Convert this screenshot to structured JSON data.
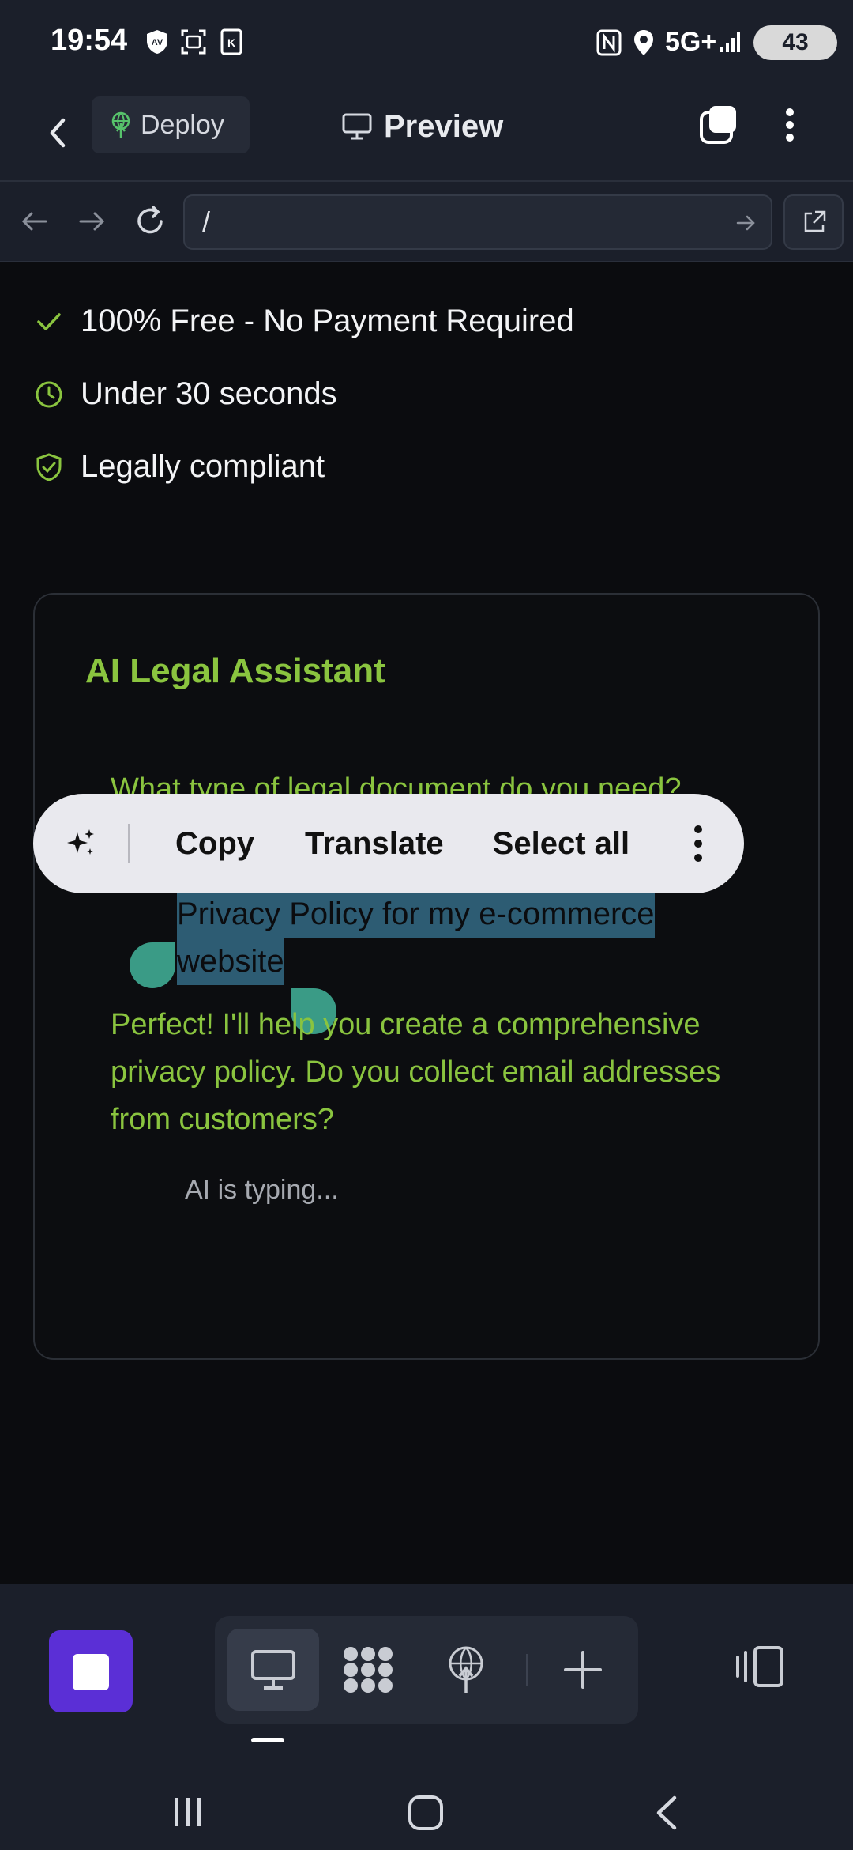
{
  "status_bar": {
    "time": "19:54",
    "network": "5G+",
    "battery": "43",
    "icons": [
      "av-shield-icon",
      "screenshot-icon",
      "k-app-icon",
      "nfc-icon",
      "location-icon",
      "signal-icon"
    ]
  },
  "header": {
    "back": "back-arrow-icon",
    "deploy_label": "Deploy",
    "title": "Preview"
  },
  "browser": {
    "url": "/"
  },
  "features": [
    {
      "icon": "check-icon",
      "label": "100% Free - No Payment Required"
    },
    {
      "icon": "clock-icon",
      "label": "Under 30 seconds"
    },
    {
      "icon": "shield-check-icon",
      "label": "Legally compliant"
    }
  ],
  "chat": {
    "title": "AI Legal Assistant",
    "question": "What type of legal document do you need?",
    "user_line1": "Privacy Policy for my e-commerce",
    "user_line2": "website",
    "answer": "Perfect! I'll help you create a comprehensive privacy policy. Do you collect email addresses from customers?",
    "typing": "AI is typing..."
  },
  "context_menu": {
    "copy": "Copy",
    "translate": "Translate",
    "select_all": "Select all"
  },
  "colors": {
    "accent_green": "#8ac43f",
    "stop_purple": "#5b2fd6",
    "selection": "#2d5c73",
    "handle": "#3a9b86"
  }
}
